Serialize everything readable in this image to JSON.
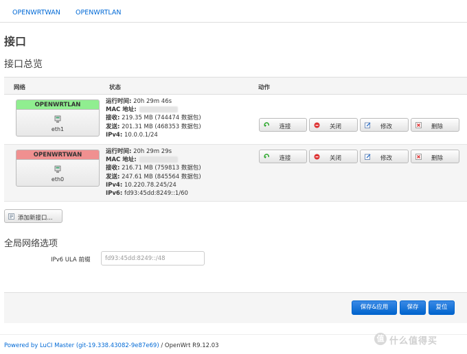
{
  "tabs": [
    {
      "label": "OPENWRTWAN"
    },
    {
      "label": "OPENWRTLAN"
    }
  ],
  "page_title": "接口",
  "overview_title": "接口总览",
  "table": {
    "headers": {
      "network": "网络",
      "status": "状态",
      "action": "动作"
    },
    "rows": [
      {
        "name": "OPENWRTLAN",
        "device": "eth1",
        "status_color": "#90ee90",
        "uptime_label": "运行时间:",
        "uptime": "20h 29m 46s",
        "mac_label": "MAC 地址:",
        "rx_label": "接收:",
        "rx": "219.35 MB (744474 数据包)",
        "tx_label": "发送:",
        "tx": "201.31 MB (468353 数据包)",
        "ipv4_label": "IPv4:",
        "ipv4": "10.0.0.1/24"
      },
      {
        "name": "OPENWRTWAN",
        "device": "eth0",
        "status_color": "#f09090",
        "uptime_label": "运行时间:",
        "uptime": "20h 29m 29s",
        "mac_label": "MAC 地址:",
        "rx_label": "接收:",
        "rx": "216.71 MB (759813 数据包)",
        "tx_label": "发送:",
        "tx": "247.61 MB (845564 数据包)",
        "ipv4_label": "IPv4:",
        "ipv4": "10.220.78.245/24",
        "ipv6_label": "IPv6:",
        "ipv6": "fd93:45dd:8249::1/60"
      }
    ],
    "buttons": {
      "connect": "连接",
      "close": "关闭",
      "edit": "修改",
      "delete": "删除"
    }
  },
  "add_interface_label": "添加新接口...",
  "global_options": {
    "title": "全局网络选项",
    "ula_label": "IPv6 ULA 前缀",
    "ula_value": "fd93:45dd:8249::/48"
  },
  "actions": {
    "save_apply": "保存&应用",
    "save": "保存",
    "reset": "复位"
  },
  "footer": {
    "link": "Powered by LuCI Master (git-19.338.43082-9e87e69)",
    "suffix": " / OpenWrt R9.12.03"
  },
  "watermark": {
    "glyph": "值",
    "text": "什么值得买"
  }
}
